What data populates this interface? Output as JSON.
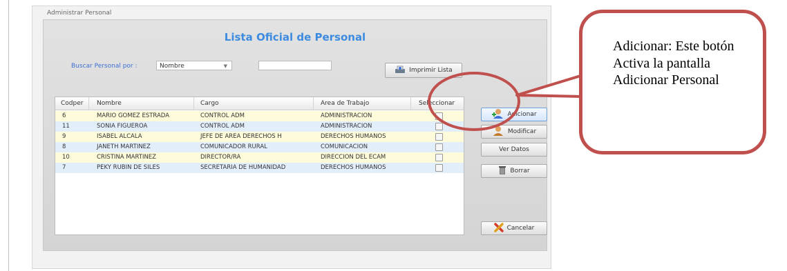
{
  "window": {
    "title": "Administrar Personal"
  },
  "list_title": "Lista  Oficial de Personal",
  "search": {
    "label": "Buscar  Personal por :",
    "select_value": "Nombre",
    "input_value": ""
  },
  "buttons": {
    "print": "Imprimir Lista",
    "add": "Adicionar",
    "modify": "Modificar",
    "view": "Ver Datos",
    "delete": "Borrar",
    "cancel": "Cancelar"
  },
  "table": {
    "headers": [
      "Codper",
      "Nombre",
      "Cargo",
      "Area de Trabajo",
      "Seleccionar"
    ],
    "rows": [
      {
        "codper": "6",
        "nombre": "MARIO GOMEZ ESTRADA",
        "cargo": "CONTROL ADM",
        "area": "ADMINISTRACION"
      },
      {
        "codper": "11",
        "nombre": "SONIA  FIGUEROA",
        "cargo": "CONTROL ADM",
        "area": "ADMINISTRACION"
      },
      {
        "codper": "9",
        "nombre": "ISABEL ALCALA",
        "cargo": "JEFE DE AREA DERECHOS H",
        "area": "DERECHOS HUMANOS"
      },
      {
        "codper": "8",
        "nombre": "JANETH MARTINEZ",
        "cargo": "COMUNICADOR RURAL",
        "area": "COMUNICACION"
      },
      {
        "codper": "10",
        "nombre": "CRISTINA  MARTINEZ",
        "cargo": "DIRECTOR/RA",
        "area": "DIRECCION DEL ECAM"
      },
      {
        "codper": "7",
        "nombre": "PEKY RUBIN DE SILES",
        "cargo": "SECRETARIA DE HUMANIDAD",
        "area": "DERECHOS HUMANOS"
      }
    ]
  },
  "callout": {
    "text": "Adicionar: Este botón Activa la pantalla Adicionar Personal"
  },
  "colors": {
    "accent_title": "#3d8be0",
    "callout_border": "#c0504d",
    "row_yellow": "#fdfbd9",
    "row_blue": "#e3eefb"
  },
  "icons": [
    "print-icon",
    "add-user-icon",
    "edit-user-icon",
    "trash-icon",
    "cancel-x-icon",
    "dropdown-arrow-icon"
  ]
}
